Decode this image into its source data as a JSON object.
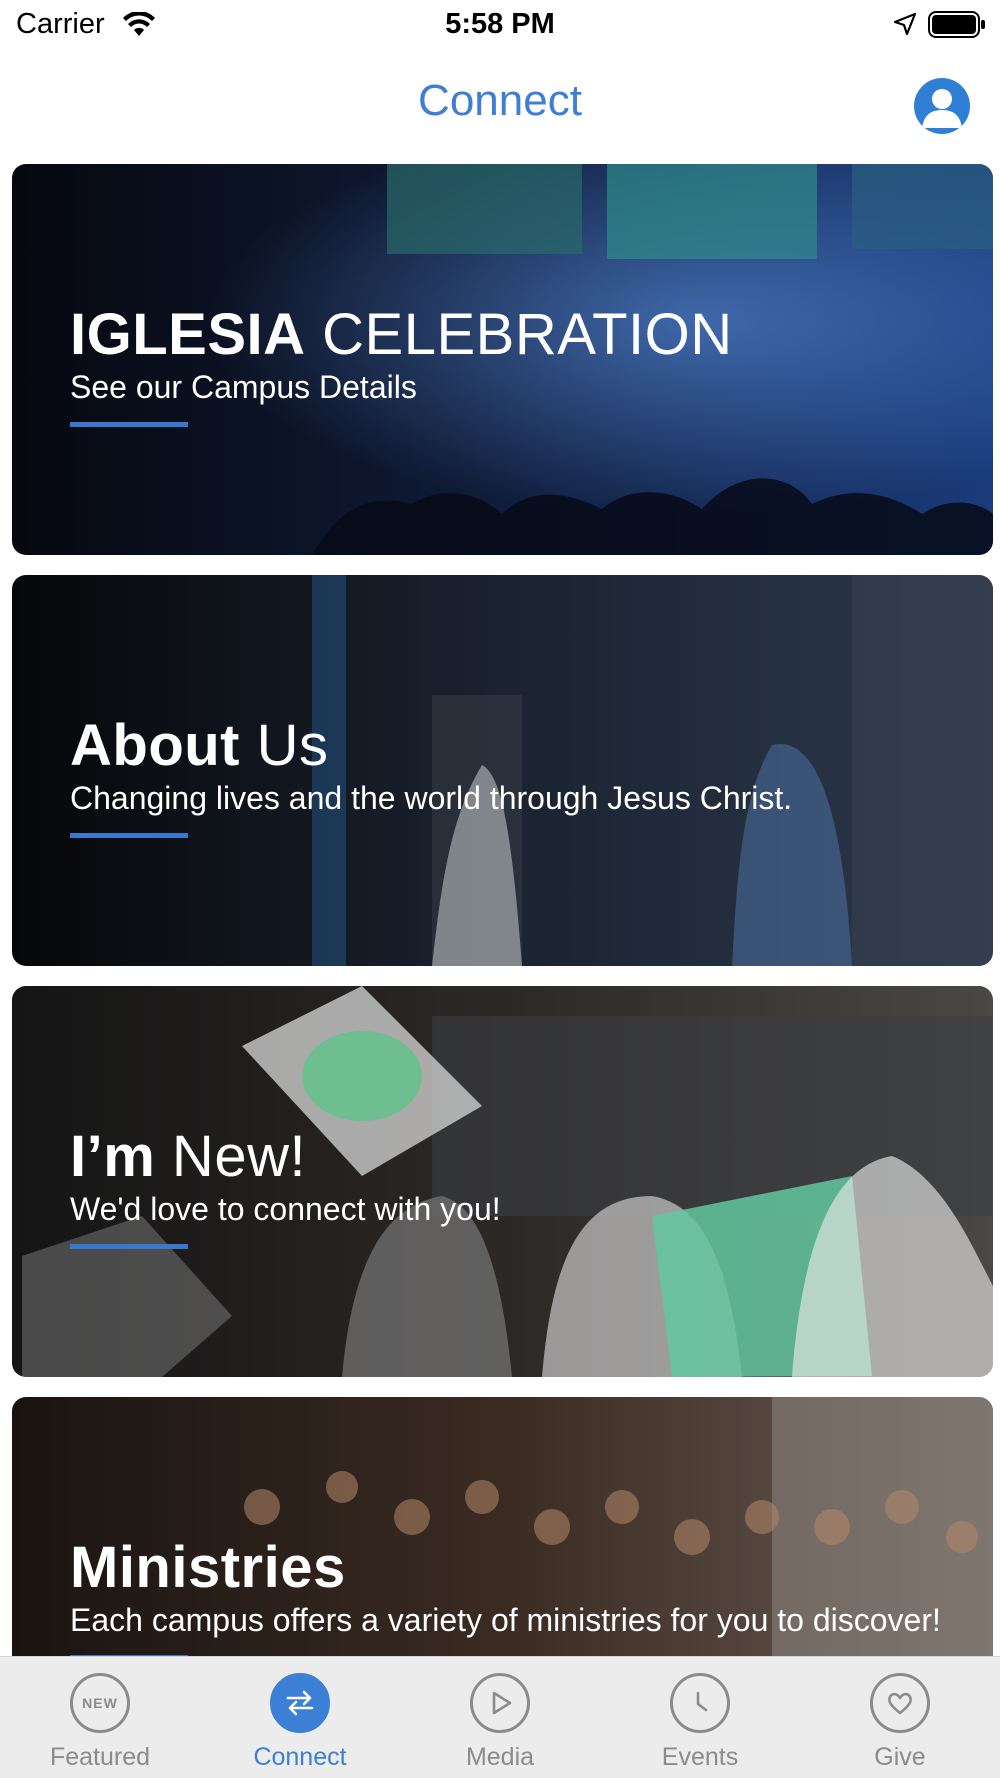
{
  "status_bar": {
    "carrier": "Carrier",
    "time": "5:58 PM"
  },
  "nav": {
    "title": "Connect",
    "profile_icon": "person-icon"
  },
  "cards": [
    {
      "title_bold": "IGLESIA",
      "title_light": " CELEBRATION",
      "subtitle": "See our Campus Details"
    },
    {
      "title_bold": "About",
      "title_light": " Us",
      "subtitle": "Changing lives and the world through Jesus Christ."
    },
    {
      "title_bold": "I’m",
      "title_light": " New!",
      "subtitle": "We'd love to connect with you!"
    },
    {
      "title_bold": "Ministries",
      "title_light": "",
      "subtitle": "Each campus offers a variety of ministries for you to discover!"
    }
  ],
  "tabs": [
    {
      "label": "Featured",
      "icon": "new-badge-icon",
      "badge": "NEW",
      "active": false
    },
    {
      "label": "Connect",
      "icon": "connect-arrows-icon",
      "active": true
    },
    {
      "label": "Media",
      "icon": "play-icon",
      "active": false
    },
    {
      "label": "Events",
      "icon": "clock-icon",
      "active": false
    },
    {
      "label": "Give",
      "icon": "heart-icon",
      "active": false
    }
  ],
  "colors": {
    "accent": "#3c80d6",
    "inactive": "#8b8b8b",
    "rule": "#3a78cc"
  }
}
